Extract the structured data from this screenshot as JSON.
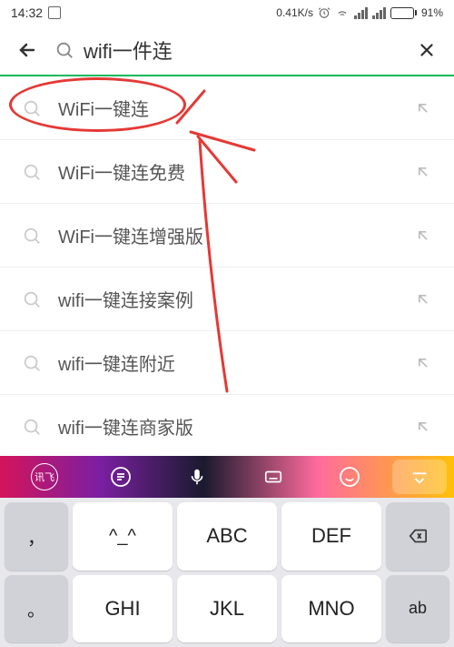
{
  "status": {
    "time": "14:32",
    "speed": "0.41K/s",
    "battery_pct": "91%"
  },
  "search": {
    "query": "wifi一件连"
  },
  "suggestions": [
    {
      "text": "WiFi一键连"
    },
    {
      "text": "WiFi一键连免费"
    },
    {
      "text": "WiFi一键连增强版"
    },
    {
      "text": "wifi一键连接案例"
    },
    {
      "text": "wifi一键连附近"
    },
    {
      "text": "wifi一键连商家版"
    }
  ],
  "keyboard": {
    "toolbar_brand": "讯飞",
    "rows": [
      {
        "side_l": "，",
        "k1": "^_^",
        "k2": "ABC",
        "k3": "DEF",
        "side_r": "⌫"
      },
      {
        "side_l": "。",
        "k1": "GHI",
        "k2": "JKL",
        "k3": "MNO",
        "side_r": "ab"
      }
    ]
  }
}
